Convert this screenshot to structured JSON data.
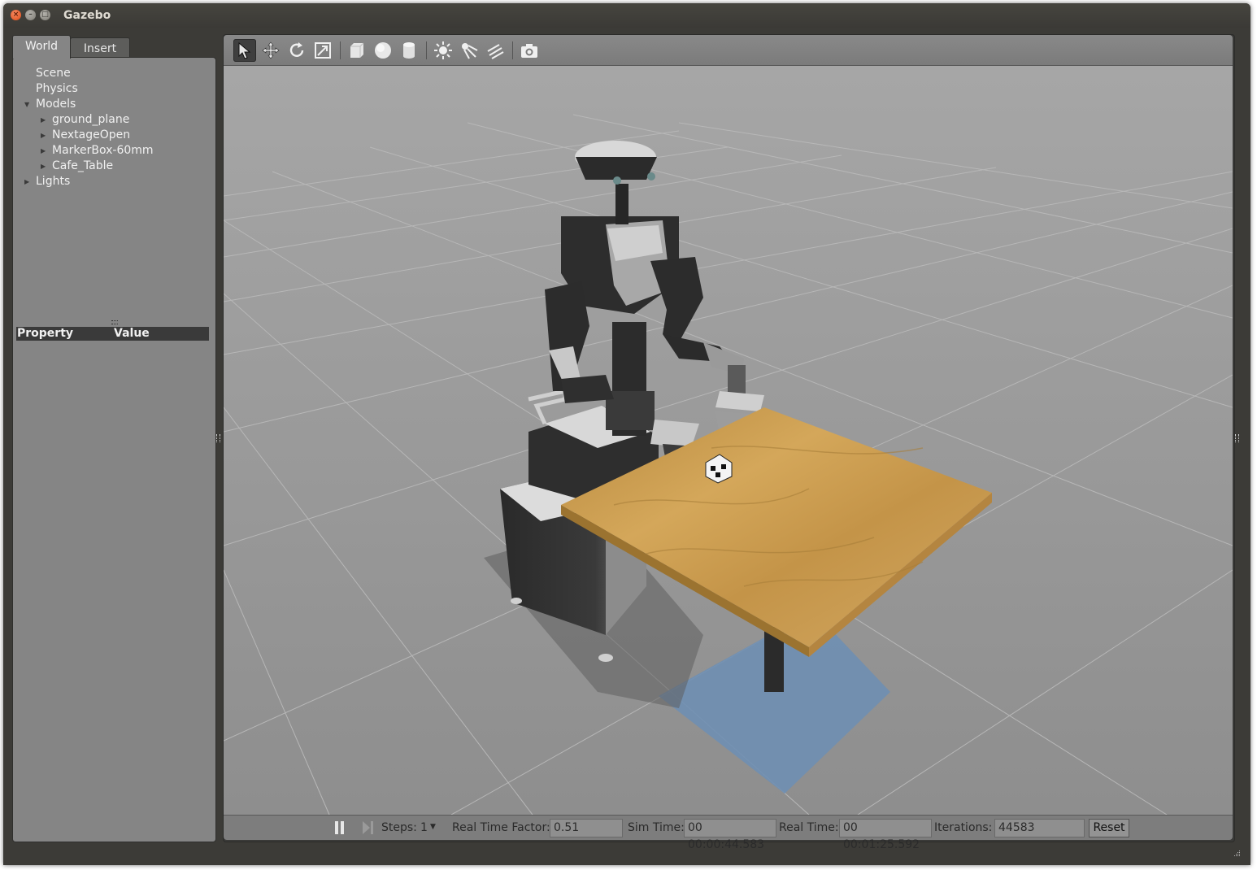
{
  "window": {
    "title": "Gazebo"
  },
  "tabs": {
    "world": "World",
    "insert": "Insert"
  },
  "tree": {
    "scene": "Scene",
    "physics": "Physics",
    "models": "Models",
    "model_items": [
      "ground_plane",
      "NextageOpen",
      "MarkerBox-60mm",
      "Cafe_Table"
    ],
    "lights": "Lights"
  },
  "properties": {
    "property_header": "Property",
    "value_header": "Value"
  },
  "toolbar": {
    "icons": [
      "select-arrow-icon",
      "translate-icon",
      "rotate-icon",
      "scale-icon",
      "box-icon",
      "sphere-icon",
      "cylinder-icon",
      "point-light-icon",
      "spot-light-icon",
      "directional-light-icon",
      "camera-icon"
    ],
    "active_tool": "select-arrow-icon"
  },
  "status": {
    "steps_label": "Steps:",
    "steps_value": "1",
    "rtf_label": "Real Time Factor:",
    "rtf_value": "0.51",
    "sim_time_label": "Sim Time:",
    "sim_time_value": "00 00:00:44.583",
    "real_time_label": "Real Time:",
    "real_time_value": "00 00:01:25.592",
    "iterations_label": "Iterations:",
    "iterations_value": "44583",
    "reset_label": "Reset"
  },
  "colors": {
    "window_bg": "#3c3b37",
    "panel_bg": "#858585",
    "ground": "#9a9a9a",
    "table_wood": "#c79a48",
    "selection_blue": "#6f8fb3"
  }
}
